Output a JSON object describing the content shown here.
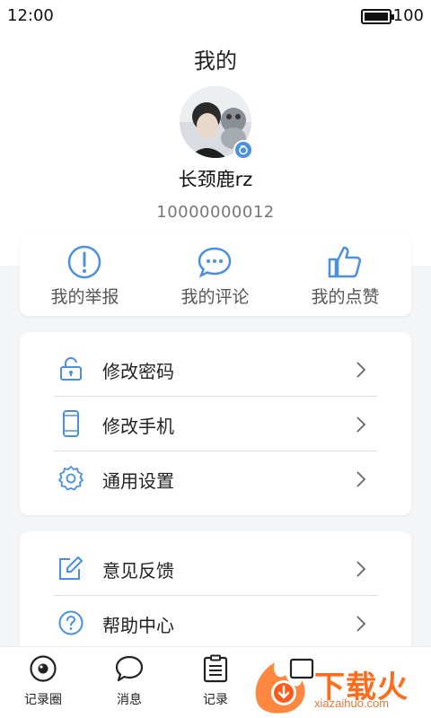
{
  "status_bar": {
    "time": "12:00",
    "battery": "100"
  },
  "header": {
    "title": "我的"
  },
  "profile": {
    "name": "长颈鹿rz",
    "id": "10000000012"
  },
  "quick_actions": [
    {
      "label": "我的举报",
      "icon": "alert-icon"
    },
    {
      "label": "我的评论",
      "icon": "comment-icon"
    },
    {
      "label": "我的点赞",
      "icon": "thumbs-up-icon"
    }
  ],
  "menu_group_1": [
    {
      "label": "修改密码",
      "icon": "lock-icon"
    },
    {
      "label": "修改手机",
      "icon": "phone-icon"
    },
    {
      "label": "通用设置",
      "icon": "gear-icon"
    }
  ],
  "menu_group_2": [
    {
      "label": "意见反馈",
      "icon": "edit-icon"
    },
    {
      "label": "帮助中心",
      "icon": "help-icon"
    }
  ],
  "tab_bar": [
    {
      "label": "记录圈",
      "icon": "eye-icon"
    },
    {
      "label": "消息",
      "icon": "message-icon"
    },
    {
      "label": "记录",
      "icon": "clipboard-icon"
    }
  ],
  "watermark": {
    "text": "下载火",
    "url": "xiazaihuo.com"
  },
  "colors": {
    "accent": "#4a90e2",
    "text": "#222222",
    "muted": "#777777",
    "watermark": "#ff6b1a"
  }
}
